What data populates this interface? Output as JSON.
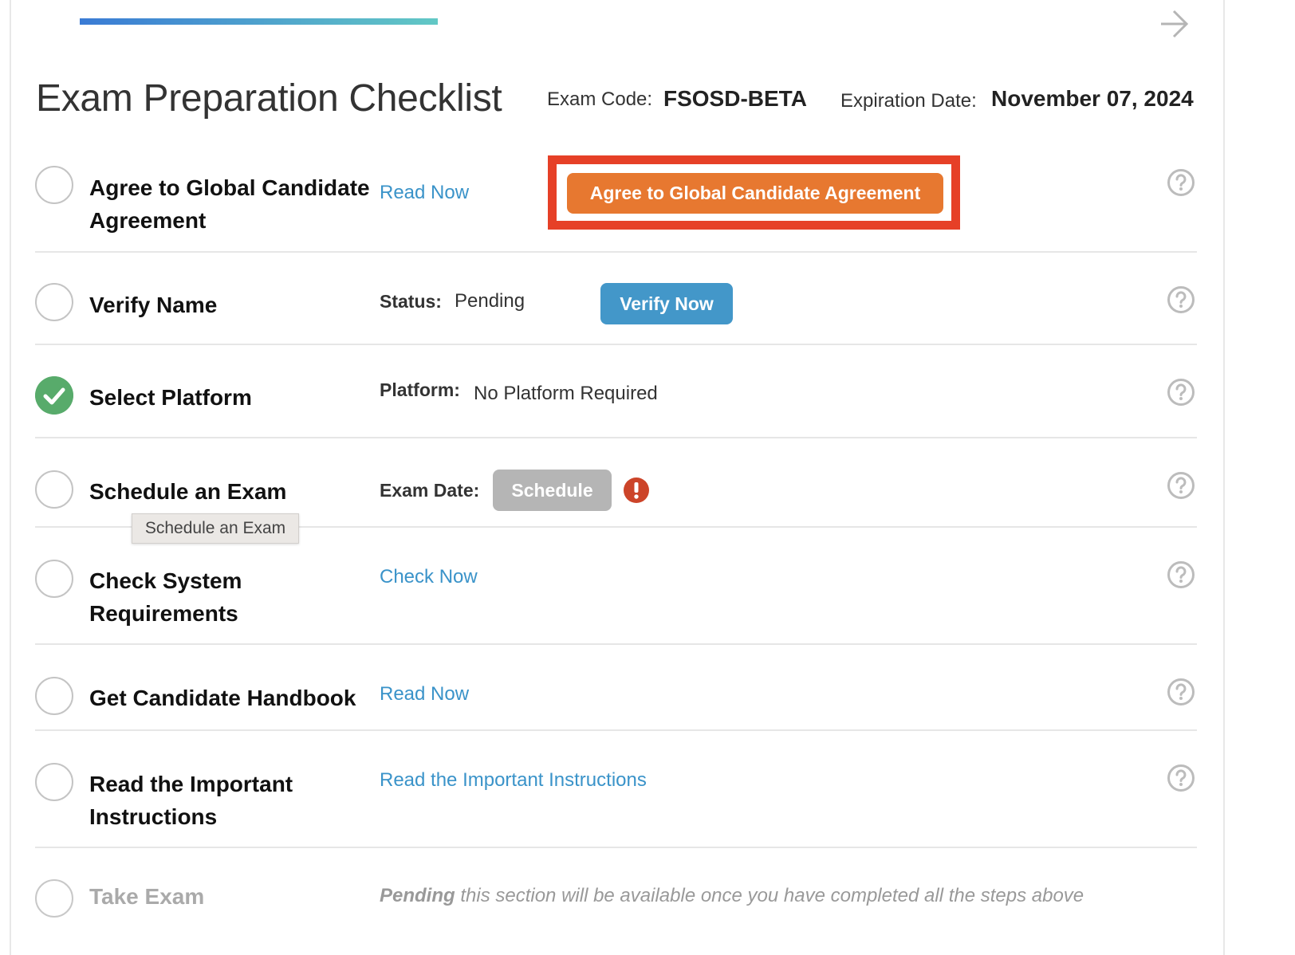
{
  "header": {
    "progress_percent": 30,
    "title": "Exam Preparation Checklist",
    "exam_code_label": "Exam Code:",
    "exam_code": "FSOSD-BETA",
    "expiration_label": "Expiration Date:",
    "expiration_date": "November 07, 2024",
    "next_icon": "arrow-right-icon"
  },
  "colors": {
    "accent_link": "#3a93c9",
    "primary_button": "#4397c9",
    "agree_button": "#e77830",
    "highlight_border": "#e64027",
    "complete_green": "#58ab6b",
    "alert_red": "#cc4429",
    "disabled_button": "#b5b5b5"
  },
  "steps": [
    {
      "title_line1": "Agree to Global Candidate",
      "title_line2": "Agreement",
      "status": "incomplete",
      "link": "Read Now",
      "button": "Agree to Global Candidate Agreement",
      "help_icon": "question-circle-icon"
    },
    {
      "title": "Verify Name",
      "status": "incomplete",
      "field_label": "Status:",
      "field_value": "Pending",
      "button": "Verify Now",
      "help_icon": "question-circle-icon"
    },
    {
      "title": "Select Platform",
      "status": "complete",
      "field_label": "Platform:",
      "field_value": "No Platform Required",
      "help_icon": "question-circle-icon"
    },
    {
      "title": "Schedule an Exam",
      "status": "incomplete",
      "field_label": "Exam Date:",
      "button": "Schedule",
      "button_disabled": true,
      "alert_icon": "exclamation-circle-icon",
      "tooltip": "Schedule an Exam",
      "help_icon": "question-circle-icon"
    },
    {
      "title_line1": "Check System",
      "title_line2": "Requirements",
      "status": "incomplete",
      "link": "Check Now",
      "help_icon": "question-circle-icon"
    },
    {
      "title": "Get Candidate Handbook",
      "status": "incomplete",
      "link": "Read Now",
      "help_icon": "question-circle-icon"
    },
    {
      "title_line1": "Read the Important",
      "title_line2": "Instructions",
      "status": "incomplete",
      "link": "Read the Important Instructions",
      "help_icon": "question-circle-icon"
    },
    {
      "title": "Take Exam",
      "status": "locked",
      "pending_emphasis": "Pending",
      "pending_text": " this section will be available once you have completed all the steps above"
    }
  ]
}
